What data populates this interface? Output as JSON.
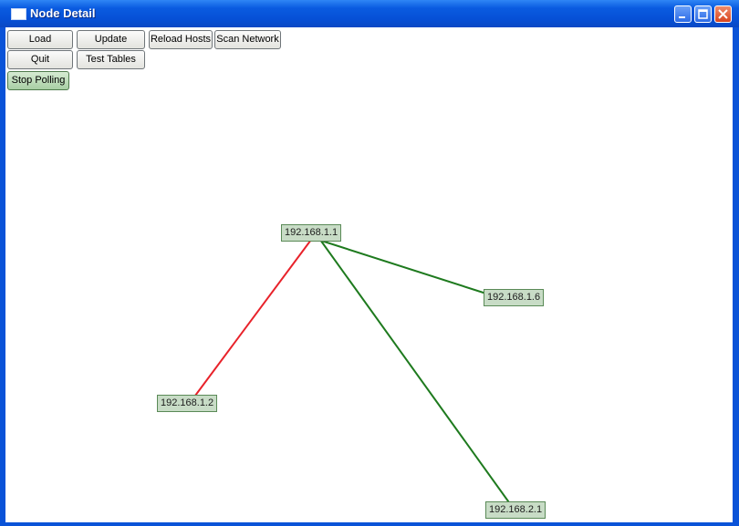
{
  "window": {
    "title": "Node Detail"
  },
  "toolbar": {
    "load": "Load",
    "update": "Update",
    "reload_hosts": "Reload Hosts",
    "scan_network": "Scan Network",
    "quit": "Quit",
    "test_tables": "Test Tables",
    "stop_polling": "Stop Polling"
  },
  "graph": {
    "nodes": [
      {
        "id": "n1",
        "label": "192.168.1.1"
      },
      {
        "id": "n2",
        "label": "192.168.1.6"
      },
      {
        "id": "n3",
        "label": "192.168.1.2"
      },
      {
        "id": "n4",
        "label": "192.168.2.1"
      }
    ],
    "links": [
      {
        "from": "192.168.1.1",
        "to": "192.168.1.2",
        "status": "down",
        "color": "#e8222a"
      },
      {
        "from": "192.168.1.1",
        "to": "192.168.1.6",
        "status": "up",
        "color": "#1e7a1e"
      },
      {
        "from": "192.168.1.1",
        "to": "192.168.2.1",
        "status": "up",
        "color": "#1e7a1e"
      }
    ]
  }
}
